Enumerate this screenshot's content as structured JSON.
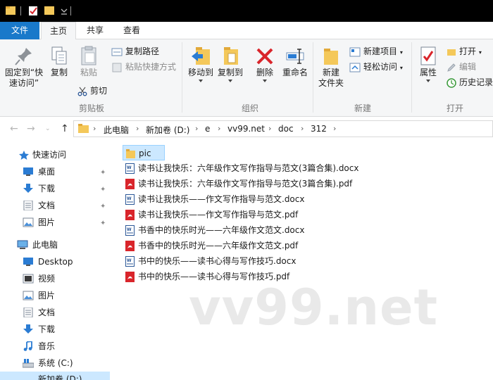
{
  "ribbon_tabs": {
    "file": "文件",
    "home": "主页",
    "share": "共享",
    "view": "查看"
  },
  "clipboard": {
    "pin_quick_access_line1": "固定到“快",
    "pin_quick_access_line2": "速访问”",
    "copy": "复制",
    "paste": "粘贴",
    "copy_path": "复制路径",
    "paste_shortcut": "粘贴快捷方式",
    "cut": "剪切",
    "group_label": "剪贴板"
  },
  "organize": {
    "move_to": "移动到",
    "copy_to": "复制到",
    "delete": "删除",
    "rename": "重命名",
    "group_label": "组织"
  },
  "new_group": {
    "new_folder_line1": "新建",
    "new_folder_line2": "文件夹",
    "new_item": "新建项目",
    "easy_access": "轻松访问",
    "group_label": "新建"
  },
  "open_group": {
    "properties": "属性",
    "open": "打开",
    "edit": "编辑",
    "history": "历史记录",
    "group_label": "打开"
  },
  "address": {
    "crumbs": [
      "此电脑",
      "新加卷 (D:)",
      "e",
      "vv99.net",
      "doc",
      "312"
    ]
  },
  "nav": {
    "quick_access": "快速访问",
    "desktop_q": "桌面",
    "downloads_q": "下载",
    "documents_q": "文档",
    "pictures_q": "图片",
    "this_pc": "此电脑",
    "desktop": "Desktop",
    "videos": "视频",
    "pictures": "图片",
    "documents": "文档",
    "downloads": "下载",
    "music": "音乐",
    "system_c": "系统 (C:)",
    "new_volume_d": "新加卷 (D:)"
  },
  "files": [
    {
      "name": "pic",
      "type": "folder"
    },
    {
      "name": "读书让我快乐：六年级作文写作指导与范文(3篇合集).docx",
      "type": "docx"
    },
    {
      "name": "读书让我快乐：六年级作文写作指导与范文(3篇合集).pdf",
      "type": "pdf"
    },
    {
      "name": "读书让我快乐——作文写作指导与范文.docx",
      "type": "docx"
    },
    {
      "name": "读书让我快乐——作文写作指导与范文.pdf",
      "type": "pdf"
    },
    {
      "name": "书香中的快乐时光——六年级作文范文.docx",
      "type": "docx"
    },
    {
      "name": "书香中的快乐时光——六年级作文范文.pdf",
      "type": "pdf"
    },
    {
      "name": "书中的快乐——读书心得与写作技巧.docx",
      "type": "docx"
    },
    {
      "name": "书中的快乐——读书心得与写作技巧.pdf",
      "type": "pdf"
    }
  ],
  "watermark": "vv99.net",
  "colors": {
    "file_tab": "#1979ca",
    "selection": "#cce8ff",
    "folder": "#f4c85a",
    "pdf": "#d9252b",
    "docx": "#2b5797"
  }
}
